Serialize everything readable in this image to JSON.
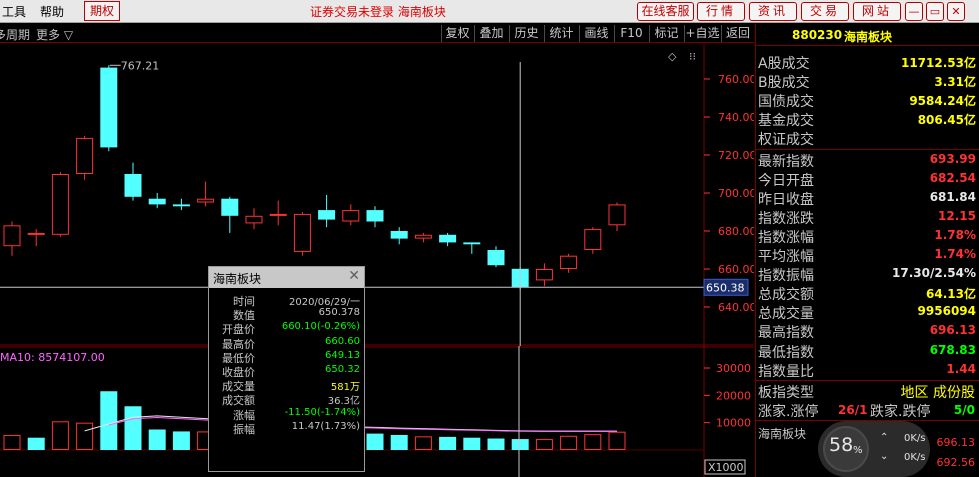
{
  "menu": {
    "items": [
      "工具",
      "帮助"
    ],
    "qiquan": "期权",
    "status": "证券交易未登录  海南板块",
    "buttons": [
      "在线客服",
      "行情",
      "资讯",
      "交易",
      "网站"
    ]
  },
  "toolbar": {
    "period": "多周期",
    "more": "更多",
    "buttons": [
      "复权",
      "叠加",
      "历史",
      "统计",
      "画线",
      "F10",
      "标记",
      "+自选",
      "返回"
    ]
  },
  "colors": {
    "up": "#ff3232",
    "down": "#54ffff",
    "panel_border": "#7a0000"
  },
  "chart_data": [
    {
      "type": "candlestick",
      "title": "",
      "ylim": [
        630,
        770
      ],
      "y_ticks": [
        "760.00",
        "740.00",
        "720.00",
        "700.00",
        "680.00",
        "660.00",
        "640.00"
      ],
      "max_label": "767.21",
      "crosshair_value": "650.38",
      "candles": [
        {
          "o": 672,
          "c": 683,
          "h": 685,
          "l": 667
        },
        {
          "o": 678,
          "c": 679,
          "h": 681,
          "l": 672
        },
        {
          "o": 678,
          "c": 710,
          "h": 711,
          "l": 677
        },
        {
          "o": 710,
          "c": 729,
          "h": 730,
          "l": 707
        },
        {
          "o": 766,
          "c": 724,
          "h": 767.21,
          "l": 722
        },
        {
          "o": 710,
          "c": 698,
          "h": 716,
          "l": 696
        },
        {
          "o": 697,
          "c": 694,
          "h": 700,
          "l": 692
        },
        {
          "o": 694,
          "c": 693,
          "h": 697,
          "l": 691
        },
        {
          "o": 695,
          "c": 697,
          "h": 706,
          "l": 693
        },
        {
          "o": 697,
          "c": 688,
          "h": 698,
          "l": 679
        },
        {
          "o": 684,
          "c": 688,
          "h": 692,
          "l": 681
        },
        {
          "o": 688,
          "c": 689,
          "h": 696,
          "l": 683
        },
        {
          "o": 669,
          "c": 689,
          "h": 690,
          "l": 667
        },
        {
          "o": 691,
          "c": 686,
          "h": 699,
          "l": 682
        },
        {
          "o": 685,
          "c": 691,
          "h": 694,
          "l": 683
        },
        {
          "o": 691,
          "c": 685,
          "h": 693,
          "l": 682
        },
        {
          "o": 680,
          "c": 676,
          "h": 682,
          "l": 673
        },
        {
          "o": 676,
          "c": 678,
          "h": 679,
          "l": 674
        },
        {
          "o": 678,
          "c": 674,
          "h": 679,
          "l": 672
        },
        {
          "o": 674,
          "c": 673,
          "h": 674,
          "l": 668
        },
        {
          "o": 670,
          "c": 662,
          "h": 672,
          "l": 661
        },
        {
          "o": 660.1,
          "c": 650.32,
          "h": 660.6,
          "l": 649.13
        },
        {
          "o": 654,
          "c": 660,
          "h": 663,
          "l": 651
        },
        {
          "o": 660,
          "c": 667,
          "h": 668,
          "l": 658
        },
        {
          "o": 670,
          "c": 681,
          "h": 682,
          "l": 668
        },
        {
          "o": 683,
          "c": 694,
          "h": 695,
          "l": 680
        }
      ]
    },
    {
      "type": "bar",
      "title": "",
      "ma_label": "MA10: 8574107.00",
      "ylim": [
        0,
        32000
      ],
      "y_ticks": [
        "30000",
        "20000",
        "10000"
      ],
      "unit": "X1000",
      "values": [
        5500,
        4500,
        10500,
        10000,
        21500,
        16000,
        7500,
        6800,
        6800,
        6000,
        6000,
        5000,
        5000,
        6000,
        7500,
        6000,
        5500,
        5000,
        4800,
        4500,
        4200,
        4000,
        4000,
        5200,
        5800,
        6700
      ],
      "up": [
        true,
        false,
        true,
        true,
        false,
        false,
        false,
        false,
        true,
        false,
        true,
        true,
        true,
        false,
        true,
        false,
        false,
        true,
        false,
        false,
        false,
        false,
        true,
        true,
        true,
        true
      ],
      "ma_line": [
        null,
        null,
        null,
        7000,
        9500,
        12000,
        12500,
        12000,
        11500,
        11000,
        10500,
        10000,
        9500,
        9000,
        8500,
        8300,
        8000,
        7800,
        7600,
        7400,
        7200,
        7000,
        6900,
        6900,
        6900,
        6900
      ]
    }
  ],
  "popup": {
    "title": "海南板块",
    "rows": [
      {
        "label": "时间",
        "value": "2020/06/29/一",
        "color": "#c8c8c8"
      },
      {
        "label": "数值",
        "value": "650.378",
        "color": "#c8c8c8"
      },
      {
        "label": "开盘价",
        "value": "660.10(-0.26%)",
        "color": "#00ff00"
      },
      {
        "label": "最高价",
        "value": "660.60",
        "color": "#00ff00"
      },
      {
        "label": "最低价",
        "value": "649.13",
        "color": "#00ff00"
      },
      {
        "label": "收盘价",
        "value": "650.32",
        "color": "#00ff00"
      },
      {
        "label": "成交量",
        "value": "581万",
        "color": "#ffff00"
      },
      {
        "label": "成交额",
        "value": "36.3亿",
        "color": "#c8c8c8"
      },
      {
        "label": "涨幅",
        "value": "-11.50(-1.74%)",
        "color": "#00ff00"
      },
      {
        "label": "振幅",
        "value": "11.47(1.73%)",
        "color": "#c8c8c8"
      }
    ]
  },
  "right_panel": {
    "code": "880230",
    "name": "海南板块",
    "rows": [
      {
        "label": "A股成交",
        "value": "11712.53亿",
        "color": "#ffff00"
      },
      {
        "label": "B股成交",
        "value": "3.31亿",
        "color": "#ffff00"
      },
      {
        "label": "国债成交",
        "value": "9584.24亿",
        "color": "#ffff00"
      },
      {
        "label": "基金成交",
        "value": "806.45亿",
        "color": "#ffff00"
      },
      {
        "label": "权证成交",
        "value": "",
        "color": "#ffff00"
      },
      {
        "label": "最新指数",
        "value": "693.99",
        "color": "#ff3232"
      },
      {
        "label": "今日开盘",
        "value": "682.54",
        "color": "#ff3232"
      },
      {
        "label": "昨日收盘",
        "value": "681.84",
        "color": "#e8e8e8"
      },
      {
        "label": "指数涨跌",
        "value": "12.15",
        "color": "#ff3232"
      },
      {
        "label": "指数涨幅",
        "value": "1.78%",
        "color": "#ff3232"
      },
      {
        "label": "平均涨幅",
        "value": "1.74%",
        "color": "#ff3232"
      },
      {
        "label": "指数振幅",
        "value": "17.30/2.54%",
        "color": "#e8e8e8"
      },
      {
        "label": "总成交额",
        "value": "64.13亿",
        "color": "#ffff00"
      },
      {
        "label": "总成交量",
        "value": "9956094",
        "color": "#ffff00"
      },
      {
        "label": "最高指数",
        "value": "696.13",
        "color": "#ff3232"
      },
      {
        "label": "最低指数",
        "value": "678.83",
        "color": "#00ff00"
      },
      {
        "label": "指数量比",
        "value": "1.44",
        "color": "#ff3232"
      }
    ],
    "board_type_label": "板指类型",
    "board_type_value": "地区 成份股",
    "rise_label": "涨家.涨停",
    "rise_value": "26/1",
    "fall_label": "跌家.跌停",
    "fall_value": "5/0",
    "mini_title": "海南板块",
    "mini_v1": "696.13",
    "mini_v2": "692.56"
  },
  "widget": {
    "percent": "58",
    "percent_sign": "%",
    "up_speed": "0K/s",
    "down_speed": "0K/s"
  }
}
